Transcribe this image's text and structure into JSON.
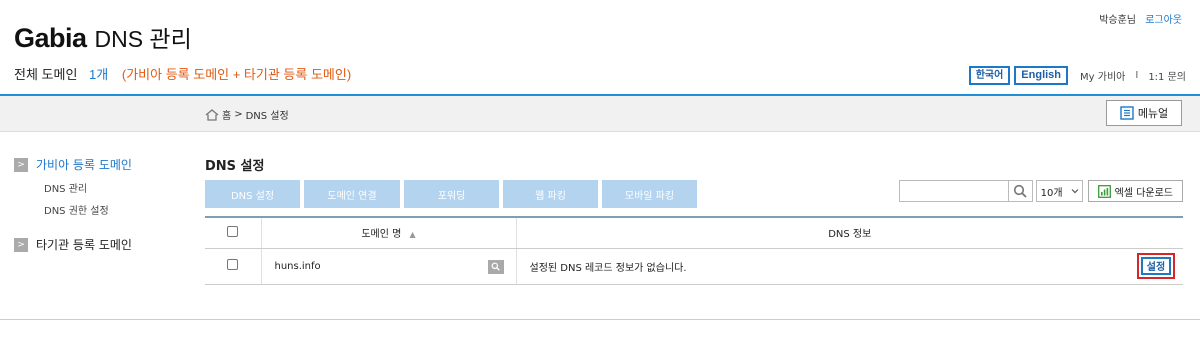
{
  "header": {
    "logo_brand": "Gabia",
    "logo_rest": "DNS 관리",
    "user_name": "박승훈님",
    "logout": "로그아웃"
  },
  "summary": {
    "label": "전체 도메인",
    "count": "1개",
    "desc": "(가비아 등록 도메인 + 타기관 등록 도메인)"
  },
  "langbar": {
    "korean": "한국어",
    "english": "English",
    "my_gabia": "My 가비아",
    "separator": "I",
    "support": "1:1 문의"
  },
  "breadcrumb": {
    "home": "홈",
    "separator": ">",
    "current": "DNS 설정"
  },
  "menu_button": "메뉴얼",
  "sidebar": {
    "group1": {
      "arrow": ">",
      "label": "가비아 등록 도메인",
      "items": [
        "DNS 관리",
        "DNS 권한 설정"
      ]
    },
    "group2": {
      "arrow": ">",
      "label": "타기관 등록 도메인"
    }
  },
  "main": {
    "title": "DNS 설정",
    "tabs": [
      "DNS 설정",
      "도메인 연결",
      "포워딩",
      "웹 파킹",
      "모바일 파킹"
    ],
    "search_placeholder": "",
    "page_size": "10개",
    "excel_button": "엑셀 다운로드"
  },
  "table": {
    "headers": {
      "domain": "도메인 명",
      "sort_mark": "▲",
      "info": "DNS 정보"
    },
    "rows": [
      {
        "domain": "huns.info",
        "info": "설정된 DNS 레코드 정보가 없습니다.",
        "action": "설정"
      }
    ]
  },
  "colors": {
    "accent": "#1e78c8",
    "orange": "#e05a10",
    "tab_bg": "#b3d3ef",
    "highlight": "#d9252a"
  }
}
